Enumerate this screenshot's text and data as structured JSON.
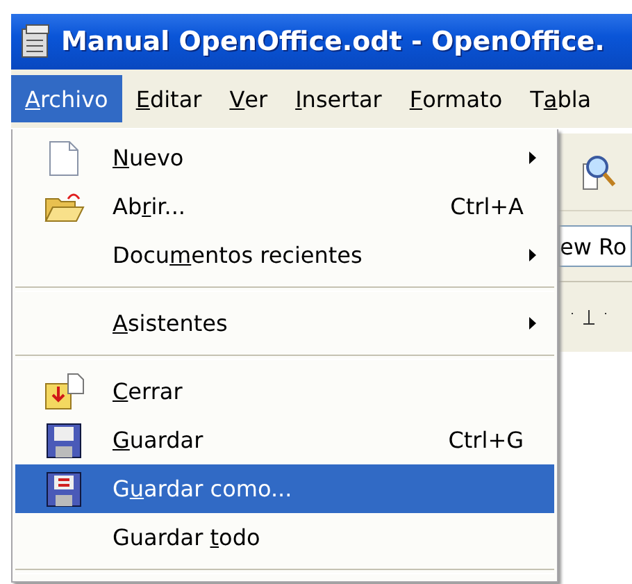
{
  "window": {
    "title": "Manual OpenOffice.odt - OpenOffice."
  },
  "menubar": [
    {
      "key": "A",
      "post": "rchivo",
      "selected": true
    },
    {
      "key": "E",
      "post": "ditar",
      "selected": false
    },
    {
      "key": "V",
      "post": "er",
      "selected": false
    },
    {
      "key": "I",
      "post": "nsertar",
      "selected": false
    },
    {
      "key": "F",
      "post": "ormato",
      "selected": false
    },
    {
      "pre": "T",
      "key": "a",
      "post": "bla",
      "selected": false
    }
  ],
  "menu": [
    {
      "kind": "item",
      "key": "N",
      "post": "uevo",
      "submenu": true,
      "selected": false
    },
    {
      "kind": "item",
      "pre": "Ab",
      "key": "r",
      "post": "ir...",
      "shortcut": "Ctrl+A",
      "submenu": false,
      "selected": false
    },
    {
      "kind": "item",
      "pre": "Docu",
      "key": "m",
      "post": "entos recientes",
      "submenu": true,
      "selected": false
    },
    {
      "kind": "separator"
    },
    {
      "kind": "item",
      "key": "A",
      "post": "sistentes",
      "submenu": true,
      "selected": false
    },
    {
      "kind": "separator"
    },
    {
      "kind": "item",
      "key": "C",
      "post": "errar",
      "submenu": false,
      "selected": false
    },
    {
      "kind": "item",
      "key": "G",
      "post": "uardar",
      "shortcut": "Ctrl+G",
      "submenu": false,
      "selected": false
    },
    {
      "kind": "item",
      "pre": "G",
      "key": "u",
      "post": "ardar como...",
      "submenu": false,
      "selected": true
    },
    {
      "kind": "item",
      "pre": "Guardar ",
      "key": "t",
      "post": "odo",
      "submenu": false,
      "selected": false
    },
    {
      "kind": "separator"
    }
  ],
  "background": {
    "font_field": "ew Ro"
  }
}
